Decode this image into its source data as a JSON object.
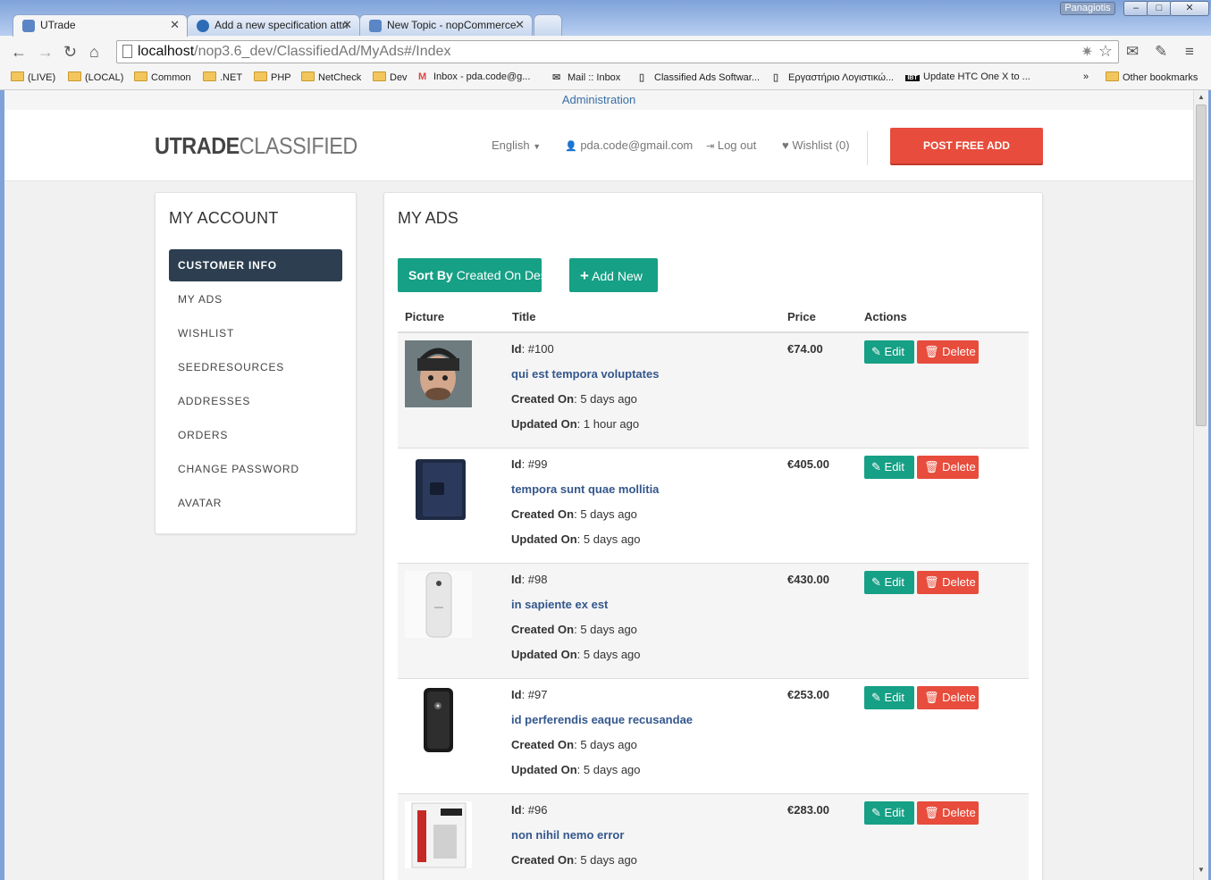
{
  "browser": {
    "user": "Panagiotis",
    "tabs": [
      {
        "title": "UTrade"
      },
      {
        "title": "Add a new specification attri"
      },
      {
        "title": "New Topic - nopCommerce"
      }
    ],
    "url_host": "localhost",
    "url_path": "/nop3.6_dev/ClassifiedAd/MyAds#/Index",
    "bookmarks": [
      "(LIVE)",
      "(LOCAL)",
      "Common",
      ".NET",
      "PHP",
      "NetCheck",
      "Dev",
      "Inbox - pda.code@g...",
      "Mail :: Inbox",
      "Classified Ads Softwar...",
      "Εργαστήριο Λογιστικώ...",
      "Update HTC One X to ...",
      "»",
      "Other bookmarks"
    ]
  },
  "site": {
    "admin_link": "Administration",
    "logo_bold": "UTRADE",
    "logo_light": "CLASSIFIED",
    "language": "English",
    "email": "pda.code@gmail.com",
    "logout": "Log out",
    "wishlist": "Wishlist (0)",
    "post_button": "POST FREE ADD"
  },
  "sidebar": {
    "title": "MY ACCOUNT",
    "items": [
      "CUSTOMER INFO",
      "MY ADS",
      "WISHLIST",
      "SEEDRESOURCES",
      "ADDRESSES",
      "ORDERS",
      "CHANGE PASSWORD",
      "AVATAR"
    ]
  },
  "main": {
    "title": "MY ADS",
    "sort_label": "Sort By",
    "sort_value": "Created On Desc",
    "add_new": "Add New",
    "columns": [
      "Picture",
      "Title",
      "Price",
      "Actions"
    ],
    "labels": {
      "id": "Id",
      "created": "Created On",
      "updated": "Updated On",
      "edit": "Edit",
      "delete": "Delete"
    },
    "ads": [
      {
        "id": "#100",
        "title": "qui est tempora voluptates",
        "created": "5 days ago",
        "updated": "1 hour ago",
        "price": "€74.00",
        "picture": "person-photo"
      },
      {
        "id": "#99",
        "title": "tempora sunt quae mollitia",
        "created": "5 days ago",
        "updated": "5 days ago",
        "price": "€405.00",
        "picture": "phone-case"
      },
      {
        "id": "#98",
        "title": "in sapiente ex est",
        "created": "5 days ago",
        "updated": "5 days ago",
        "price": "€430.00",
        "picture": "white-phone"
      },
      {
        "id": "#97",
        "title": "id perferendis eaque recusandae",
        "created": "5 days ago",
        "updated": "5 days ago",
        "price": "€253.00",
        "picture": "black-phone"
      },
      {
        "id": "#96",
        "title": "non nihil nemo error",
        "created": "5 days ago",
        "updated": "",
        "price": "€283.00",
        "picture": "phone-package"
      }
    ]
  }
}
